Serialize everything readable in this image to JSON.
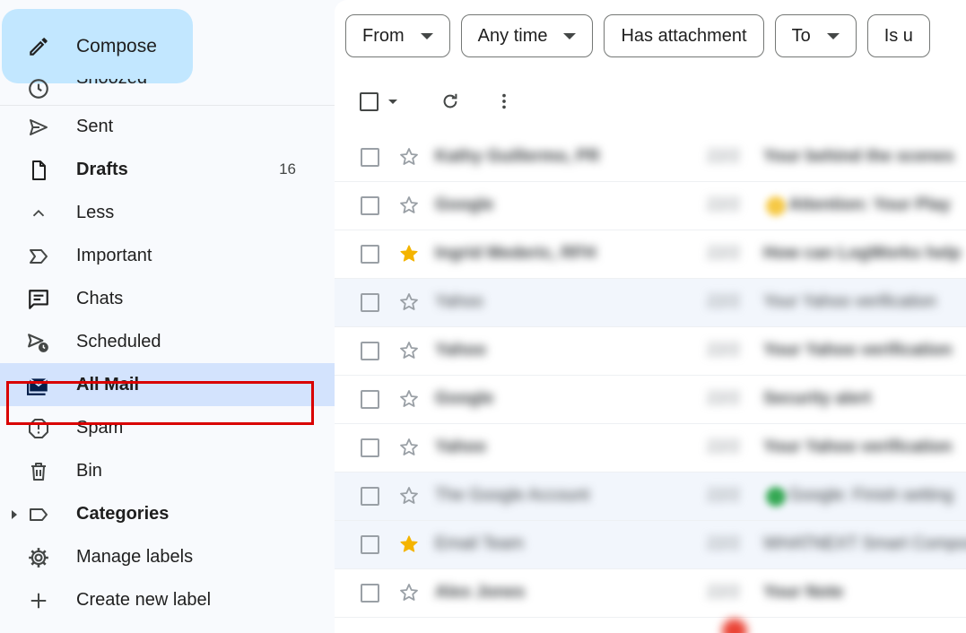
{
  "compose": {
    "label": "Compose",
    "icon": "pencil-icon"
  },
  "nav": {
    "snoozed": {
      "label": "Snoozed",
      "icon": "clock-icon"
    },
    "sent": {
      "label": "Sent",
      "icon": "send-icon"
    },
    "drafts": {
      "label": "Drafts",
      "count": "16",
      "icon": "draft-icon"
    },
    "less": {
      "label": "Less",
      "icon": "chevron-up-icon"
    },
    "important": {
      "label": "Important",
      "icon": "label-important-icon"
    },
    "chats": {
      "label": "Chats",
      "icon": "chat-icon"
    },
    "scheduled": {
      "label": "Scheduled",
      "icon": "schedule-send-icon"
    },
    "all_mail": {
      "label": "All Mail",
      "icon": "all-mail-icon"
    },
    "spam": {
      "label": "Spam",
      "icon": "spam-icon"
    },
    "bin": {
      "label": "Bin",
      "icon": "trash-icon"
    },
    "categories": {
      "label": "Categories",
      "icon": "label-icon"
    },
    "manage_labels": {
      "label": "Manage labels",
      "icon": "gear-icon"
    },
    "create_label": {
      "label": "Create new label",
      "icon": "plus-icon"
    }
  },
  "filters": [
    {
      "label": "From"
    },
    {
      "label": "Any time"
    },
    {
      "label": "Has attachment"
    },
    {
      "label": "To"
    },
    {
      "label": "Is u"
    }
  ],
  "toolbar": {
    "select": "checkbox-icon",
    "refresh": "refresh-icon",
    "more": "more-vert-icon"
  },
  "messages": [
    {
      "sender": "Kathy Guillermo, PR",
      "date": "22/2",
      "subject": "Your behind the scenes",
      "starred": false,
      "read": false
    },
    {
      "sender": "Google",
      "date": "22/2",
      "subject": "Attention: Your Play",
      "starred": false,
      "read": false
    },
    {
      "sender": "Ingrid Mederic, RFH",
      "date": "22/2",
      "subject": "How can LogWorks help",
      "starred": true,
      "read": false
    },
    {
      "sender": "Yahoo",
      "date": "22/2",
      "subject": "Your Yahoo verification",
      "starred": false,
      "read": true
    },
    {
      "sender": "Yahoo",
      "date": "22/2",
      "subject": "Your Yahoo verification",
      "starred": false,
      "read": false
    },
    {
      "sender": "Google",
      "date": "22/2",
      "subject": "Security alert",
      "starred": false,
      "read": false
    },
    {
      "sender": "Yahoo",
      "date": "22/2",
      "subject": "Your Yahoo verification",
      "starred": false,
      "read": false
    },
    {
      "sender": "The Google Account",
      "date": "22/2",
      "subject": "Google: Finish setting",
      "starred": false,
      "read": true
    },
    {
      "sender": "Email Team",
      "date": "22/2",
      "subject": "WHATNEXT Smart Compose",
      "starred": true,
      "read": true
    },
    {
      "sender": "Alex Jones",
      "date": "22/2",
      "subject": "Your Note",
      "starred": false,
      "read": false
    }
  ],
  "colors": {
    "compose_bg": "#c2e7ff",
    "active_bg": "#d3e3fd",
    "highlight": "#d90000",
    "star": "#f4b400"
  }
}
